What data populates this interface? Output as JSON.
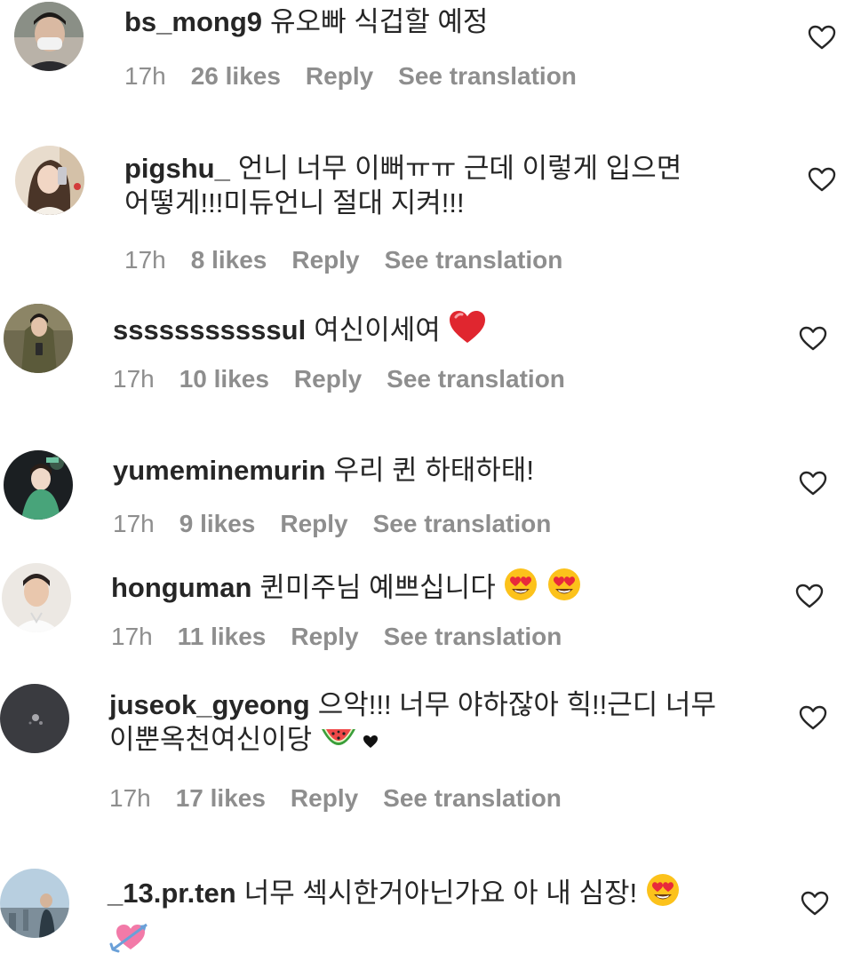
{
  "comments": [
    {
      "username": "bs_mong9",
      "text": "유오빠 식겁할 예정",
      "time": "17h",
      "likes": "26 likes",
      "reply": "Reply",
      "translate": "See translation"
    },
    {
      "username": "pigshu_",
      "text": "언니 너무 이뻐ㅠㅠ 근데 이렇게 입으면 어떻게!!!미듀언니 절대 지켜!!!",
      "time": "17h",
      "likes": "8 likes",
      "reply": "Reply",
      "translate": "See translation"
    },
    {
      "username": "sssssssssssul",
      "text": "여신이세여",
      "emoji": "red-heart",
      "time": "17h",
      "likes": "10 likes",
      "reply": "Reply",
      "translate": "See translation"
    },
    {
      "username": "yumeminemurin",
      "text": "우리 퀸 하태하태!",
      "time": "17h",
      "likes": "9 likes",
      "reply": "Reply",
      "translate": "See translation"
    },
    {
      "username": "honguman",
      "text": "퀸미주님 예쁘십니다",
      "emoji": "heart-eyes x2",
      "time": "17h",
      "likes": "11 likes",
      "reply": "Reply",
      "translate": "See translation"
    },
    {
      "username": "juseok_gyeong",
      "text": "으악!!! 너무 야하잖아 힉!!근디 너무 이뿐옥천여신이당",
      "emoji": "watermelon, black heart",
      "time": "17h",
      "likes": "17 likes",
      "reply": "Reply",
      "translate": "See translation"
    },
    {
      "username": "_13.pr.ten",
      "text": "너무 섹시한거아닌가요 아 내 심장!",
      "emoji": "heart-eyes, heart-with-arrow",
      "time": "",
      "likes": "",
      "reply": "",
      "translate": ""
    }
  ],
  "icons": {
    "like": "heart-outline-icon"
  },
  "colors": {
    "text": "#262626",
    "meta": "#8e8e8e",
    "background": "#ffffff"
  }
}
